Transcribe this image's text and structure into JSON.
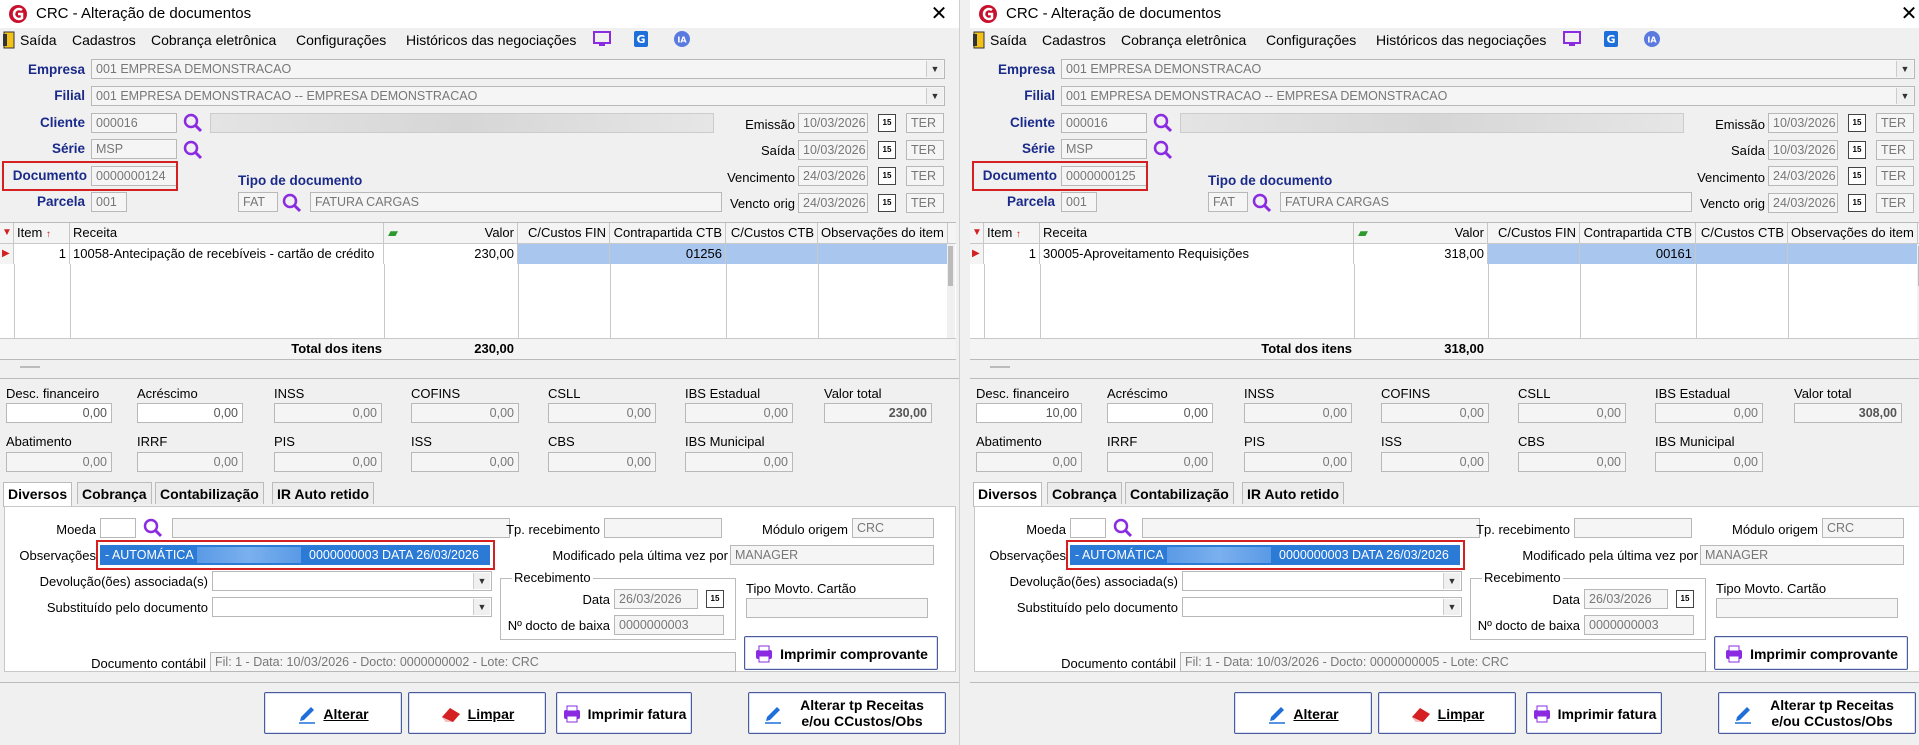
{
  "windows": [
    {
      "title": "CRC - Alteração de documentos",
      "menu": [
        "Saída",
        "Cadastros",
        "Cobrança eletrônica",
        "Configurações",
        "Históricos das negociações"
      ],
      "header": {
        "empresa_label": "Empresa",
        "empresa": "001 EMPRESA DEMONSTRACAO",
        "filial_label": "Filial",
        "filial": "001 EMPRESA DEMONSTRACAO -- EMPRESA DEMONSTRACAO",
        "cliente_label": "Cliente",
        "cliente": "000016",
        "serie_label": "Série",
        "serie": "MSP",
        "documento_label": "Documento",
        "documento": "0000000124",
        "parcela_label": "Parcela",
        "parcela": "001",
        "tipo_doc_label": "Tipo de documento",
        "tipo_doc_code": "FAT",
        "tipo_doc_desc": "FATURA CARGAS",
        "emissao_label": "Emissão",
        "emissao": "10/03/2026",
        "emissao_day": "TER",
        "saida_label": "Saída",
        "saida": "10/03/2026",
        "saida_day": "TER",
        "vencimento_label": "Vencimento",
        "vencimento": "24/03/2026",
        "vencimento_day": "TER",
        "vencto_orig_label": "Vencto orig",
        "vencto_orig": "24/03/2026",
        "vencto_orig_day": "TER"
      },
      "grid": {
        "headers": [
          "Item",
          "Receita",
          "Valor",
          "C/Custos FIN",
          "Contrapartida CTB",
          "C/Custos CTB",
          "Observações do item"
        ],
        "row": {
          "item": "1",
          "receita": "10058-Antecipação de recebíveis - cartão de crédito",
          "valor": "230,00",
          "c_custos_fin": "",
          "contrapartida": "01256",
          "c_custos_ctb": "",
          "obs": ""
        },
        "total_label": "Total dos itens",
        "total": "230,00"
      },
      "totals": {
        "desc_fin_label": "Desc. financeiro",
        "desc_fin": "0,00",
        "acrescimo_label": "Acréscimo",
        "acrescimo": "0,00",
        "inss_label": "INSS",
        "inss": "0,00",
        "cofins_label": "COFINS",
        "cofins": "0,00",
        "csll_label": "CSLL",
        "csll": "0,00",
        "ibs_est_label": "IBS Estadual",
        "ibs_est": "0,00",
        "valor_total_label": "Valor total",
        "valor_total": "230,00",
        "abatimento_label": "Abatimento",
        "abatimento": "0,00",
        "irrf_label": "IRRF",
        "irrf": "0,00",
        "pis_label": "PIS",
        "pis": "0,00",
        "iss_label": "ISS",
        "iss": "0,00",
        "cbs_label": "CBS",
        "cbs": "0,00",
        "ibs_mun_label": "IBS Municipal",
        "ibs_mun": "0,00"
      },
      "tabs": [
        "Diversos",
        "Cobrança",
        "Contabilização",
        "IR Auto retido"
      ],
      "diversos": {
        "moeda_label": "Moeda",
        "moeda": "",
        "tp_receb_label": "Tp. recebimento",
        "tp_receb": "",
        "modulo_label": "Módulo origem",
        "modulo": "CRC",
        "obs_label": "Observações",
        "obs_left": "- AUTOMÁTICA 237/",
        "obs_right": "0000000003 DATA 26/03/2026",
        "modificado_label": "Modificado pela última vez por",
        "modificado": "MANAGER",
        "devolucao_label": "Devolução(ões) associada(s)",
        "substituido_label": "Substituído pelo documento",
        "recebimento_group": "Recebimento",
        "data_label": "Data",
        "data": "26/03/2026",
        "n_docto_label": "Nº docto de baixa",
        "n_docto": "0000000003",
        "tipo_movto_label": "Tipo Movto. Cartão",
        "imprimir_comprovante": "Imprimir comprovante",
        "doc_contabil_label": "Documento contábil",
        "doc_contabil": "Fil: 1 - Data: 10/03/2026 - Docto: 0000000002 - Lote: CRC"
      },
      "buttons": {
        "alterar": "Alterar",
        "limpar": "Limpar",
        "imprimir_fatura": "Imprimir fatura",
        "alterar_tp_1": "Alterar tp Receitas",
        "alterar_tp_2": "e/ou CCustos/Obs"
      }
    },
    {
      "title": "CRC - Alteração de documentos",
      "menu": [
        "Saída",
        "Cadastros",
        "Cobrança eletrônica",
        "Configurações",
        "Históricos das negociações"
      ],
      "header": {
        "empresa_label": "Empresa",
        "empresa": "001 EMPRESA DEMONSTRACAO",
        "filial_label": "Filial",
        "filial": "001 EMPRESA DEMONSTRACAO -- EMPRESA DEMONSTRACAO",
        "cliente_label": "Cliente",
        "cliente": "000016",
        "serie_label": "Série",
        "serie": "MSP",
        "documento_label": "Documento",
        "documento": "0000000125",
        "parcela_label": "Parcela",
        "parcela": "001",
        "tipo_doc_label": "Tipo de documento",
        "tipo_doc_code": "FAT",
        "tipo_doc_desc": "FATURA CARGAS",
        "emissao_label": "Emissão",
        "emissao": "10/03/2026",
        "emissao_day": "TER",
        "saida_label": "Saída",
        "saida": "10/03/2026",
        "saida_day": "TER",
        "vencimento_label": "Vencimento",
        "vencimento": "24/03/2026",
        "vencimento_day": "TER",
        "vencto_orig_label": "Vencto orig",
        "vencto_orig": "24/03/2026",
        "vencto_orig_day": "TER"
      },
      "grid": {
        "headers": [
          "Item",
          "Receita",
          "Valor",
          "C/Custos FIN",
          "Contrapartida CTB",
          "C/Custos CTB",
          "Observações do item"
        ],
        "row": {
          "item": "1",
          "receita": "30005-Aproveitamento Requisições",
          "valor": "318,00",
          "c_custos_fin": "",
          "contrapartida": "00161",
          "c_custos_ctb": "",
          "obs": ""
        },
        "total_label": "Total dos itens",
        "total": "318,00"
      },
      "totals": {
        "desc_fin_label": "Desc. financeiro",
        "desc_fin": "10,00",
        "acrescimo_label": "Acréscimo",
        "acrescimo": "0,00",
        "inss_label": "INSS",
        "inss": "0,00",
        "cofins_label": "COFINS",
        "cofins": "0,00",
        "csll_label": "CSLL",
        "csll": "0,00",
        "ibs_est_label": "IBS Estadual",
        "ibs_est": "0,00",
        "valor_total_label": "Valor total",
        "valor_total": "308,00",
        "abatimento_label": "Abatimento",
        "abatimento": "0,00",
        "irrf_label": "IRRF",
        "irrf": "0,00",
        "pis_label": "PIS",
        "pis": "0,00",
        "iss_label": "ISS",
        "iss": "0,00",
        "cbs_label": "CBS",
        "cbs": "0,00",
        "ibs_mun_label": "IBS Municipal",
        "ibs_mun": "0,00"
      },
      "tabs": [
        "Diversos",
        "Cobrança",
        "Contabilização",
        "IR Auto retido"
      ],
      "diversos": {
        "moeda_label": "Moeda",
        "moeda": "",
        "tp_receb_label": "Tp. recebimento",
        "tp_receb": "",
        "modulo_label": "Módulo origem",
        "modulo": "CRC",
        "obs_label": "Observações",
        "obs_left": "- AUTOMÁTICA 237/",
        "obs_right": "0000000003 DATA 26/03/2026",
        "modificado_label": "Modificado pela última vez por",
        "modificado": "MANAGER",
        "devolucao_label": "Devolução(ões) associada(s)",
        "substituido_label": "Substituído pelo documento",
        "recebimento_group": "Recebimento",
        "data_label": "Data",
        "data": "26/03/2026",
        "n_docto_label": "Nº docto de baixa",
        "n_docto": "0000000003",
        "tipo_movto_label": "Tipo Movto. Cartão",
        "imprimir_comprovante": "Imprimir comprovante",
        "doc_contabil_label": "Documento contábil",
        "doc_contabil": "Fil: 1 - Data: 10/03/2026 - Docto: 0000000005 - Lote: CRC"
      },
      "buttons": {
        "alterar": "Alterar",
        "limpar": "Limpar",
        "imprimir_fatura": "Imprimir fatura",
        "alterar_tp_1": "Alterar tp Receitas",
        "alterar_tp_2": "e/ou CCustos/Obs"
      }
    }
  ],
  "colors": {
    "label_blue": "#1a2a8a",
    "highlight": "#2a7ad6",
    "row_select": "#a9c6ef",
    "red_box": "#d42020",
    "brand_red": "#c8102e"
  },
  "icons": [
    "app-logo-icon",
    "exit-icon",
    "monitor-icon",
    "g-icon",
    "ia-icon",
    "search-icon",
    "calendar-icon",
    "money-icon",
    "pencil-icon",
    "eraser-icon",
    "printer-icon"
  ]
}
